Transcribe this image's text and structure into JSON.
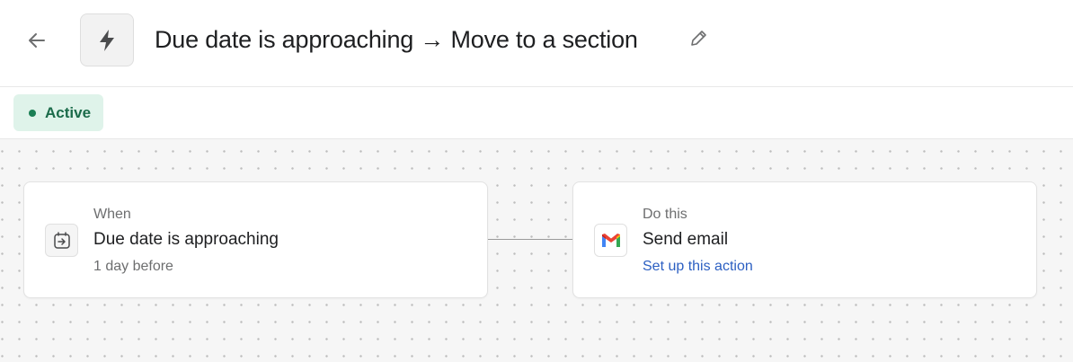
{
  "header": {
    "title": "Due date is approaching → Move to a section",
    "back_icon": "arrow-left-icon",
    "rule_icon": "lightning-bolt-icon",
    "edit_icon": "pencil-icon"
  },
  "status": {
    "label": "Active",
    "color": "#1b7f55",
    "background": "#dff3ea"
  },
  "trigger": {
    "kicker": "When",
    "title": "Due date is approaching",
    "detail": "1 day before",
    "icon": "calendar-arrow-icon"
  },
  "action": {
    "kicker": "Do this",
    "title": "Send email",
    "link": "Set up this action",
    "icon": "gmail-icon",
    "link_color": "#2c5fc2"
  }
}
